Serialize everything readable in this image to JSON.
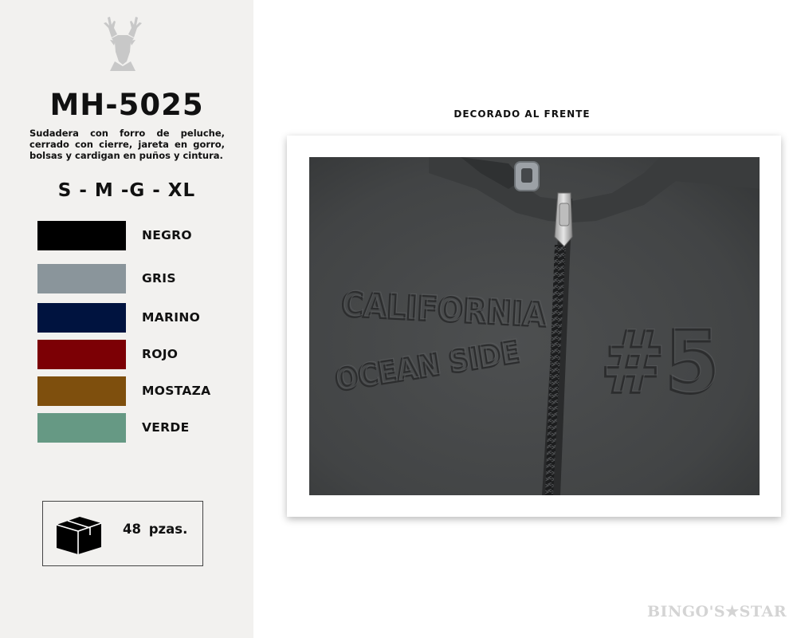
{
  "product": {
    "code": "MH-5025",
    "description": "Sudadera con forro de peluche, cerrado con cierre, jareta en gorro, bolsas y cardigan en puños y cintura.",
    "sizes": "S - M -G - XL"
  },
  "logo": {
    "icon": "deer-head-icon"
  },
  "colors": [
    {
      "label": "NEGRO",
      "hex": "#000000"
    },
    {
      "label": "GRIS",
      "hex": "#8a959b"
    },
    {
      "label": "MARINO",
      "hex": "#00133f"
    },
    {
      "label": "ROJO",
      "hex": "#7c0005"
    },
    {
      "label": "MOSTAZA",
      "hex": "#7e4f0d"
    },
    {
      "label": "VERDE",
      "hex": "#669984"
    }
  ],
  "pack": {
    "icon": "box-icon",
    "quantity": "48 pzas."
  },
  "photo": {
    "caption": "DECORADO AL FRENTE",
    "embossed_text_line1": "CALIFORNIA",
    "embossed_text_line2": "OCEAN SIDE",
    "embossed_number": "#5"
  },
  "brand": {
    "watermark": "BINGO'S★STAR"
  }
}
